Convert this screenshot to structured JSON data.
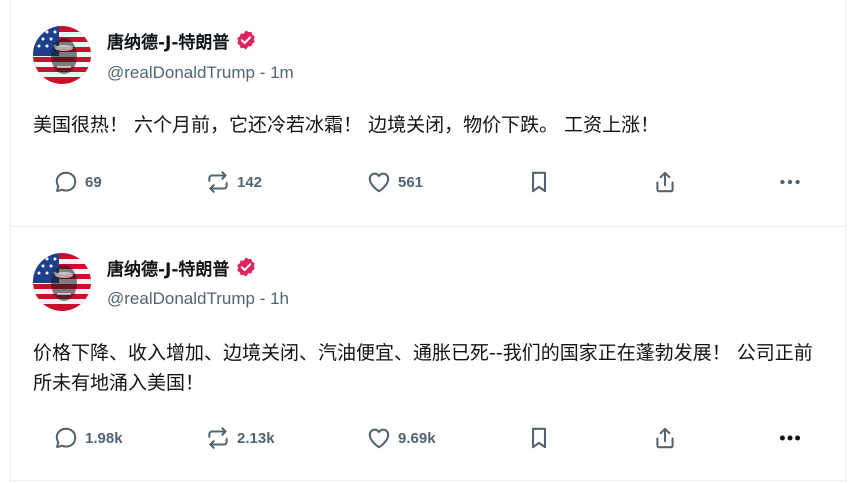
{
  "posts": [
    {
      "display_name": "唐纳德-J-特朗普",
      "handle": "@realDonaldTrump",
      "separator": " - ",
      "time": "1m",
      "text": "美国很热！ 六个月前，它还冷若冰霜！ 边境关闭，物价下跌。 工资上涨！",
      "replies": "69",
      "reposts": "142",
      "likes": "561"
    },
    {
      "display_name": "唐纳德-J-特朗普",
      "handle": "@realDonaldTrump",
      "separator": " - ",
      "time": "1h",
      "text": "价格下降、收入增加、边境关闭、汽油便宜、通胀已死--我们的国家正在蓬勃发展！ 公司正前所未有地涌入美国！",
      "replies": "1.98k",
      "reposts": "2.13k",
      "likes": "9.69k"
    }
  ],
  "icons": {
    "avatar": "flag-portrait-avatar",
    "verified": "verified-badge-icon",
    "reply": "reply-icon",
    "repost": "repost-icon",
    "like": "heart-icon",
    "bookmark": "bookmark-icon",
    "share": "share-icon",
    "more": "more-icon"
  },
  "colors": {
    "verified": "#e0245e",
    "muted": "#536471",
    "text": "#0f1419"
  }
}
